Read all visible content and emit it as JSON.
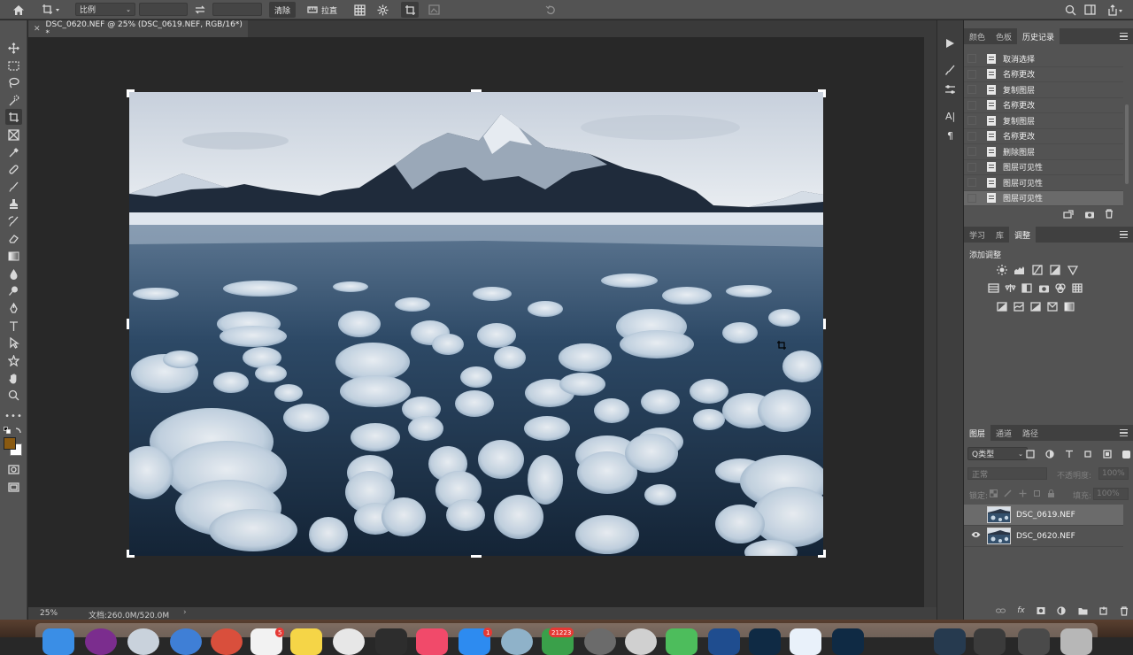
{
  "options_bar": {
    "ratio_select": "比例",
    "clear_label": "清除",
    "straighten_label": "拉直"
  },
  "document": {
    "tab_title": "DSC_0620.NEF @ 25% (DSC_0619.NEF, RGB/16*) *"
  },
  "status_bar": {
    "zoom": "25%",
    "doc_info": "文档:260.0M/520.0M"
  },
  "panels": {
    "top_tabs": [
      "颜色",
      "色板",
      "历史记录"
    ],
    "history_items": [
      "取消选择",
      "名称更改",
      "复制图层",
      "名称更改",
      "复制图层",
      "名称更改",
      "删除图层",
      "图层可见性",
      "图层可见性",
      "图层可见性"
    ],
    "mid_tabs": [
      "学习",
      "库",
      "调整"
    ],
    "adjust_title": "添加调整",
    "layer_tabs": [
      "图层",
      "通道",
      "路径"
    ],
    "kind_filter": "Q类型",
    "blend_mode": "正常",
    "opacity_label": "不透明度:",
    "opacity_value": "100%",
    "lock_label": "锁定:",
    "fill_label": "填充:",
    "fill_value": "100%",
    "layers": [
      {
        "name": "DSC_0619.NEF",
        "visible": false,
        "selected": true
      },
      {
        "name": "DSC_0620.NEF",
        "visible": true,
        "selected": false
      }
    ]
  },
  "colors": {
    "foreground": "#8a5a12",
    "background": "#ffffff"
  },
  "dock": {
    "badges": [
      "5",
      "1",
      "21223"
    ]
  }
}
